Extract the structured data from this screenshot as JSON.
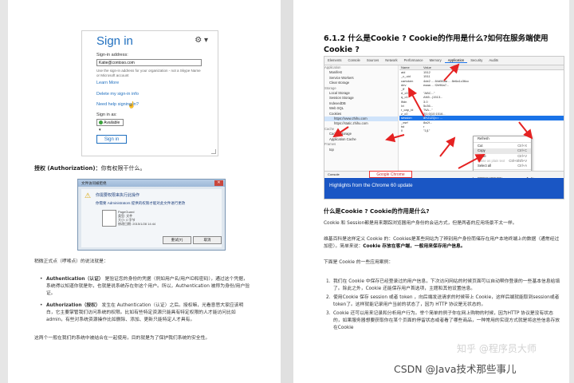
{
  "left": {
    "signin": {
      "title": "Sign in",
      "address_label": "Sign-in address:",
      "address_value": "Katie@contoso.com",
      "hint": "Use the sign-in address for your organization - not a Skype Name or Microsoft account",
      "learn_more": "Learn More",
      "delete_info": "Delete my sign-in info",
      "help": "Need help signing in?",
      "sign_in_as": "Sign in as:",
      "status": "Available",
      "button": "Sign in"
    },
    "auth_label": "授权 (Authorization)：",
    "auth_text": "你有权限干什么。",
    "dialog": {
      "title": "文件访问被拒绝",
      "message_1": "你需要权限来执行此操作",
      "message_2": "你需要 Administrators 提供的权限才能对此文件进行更改",
      "file_info": [
        "PageGuard",
        "类型: 文件",
        "大小: 0 字节",
        "修改日期: 2015/1/28 14:44"
      ],
      "retry": "重试(T)",
      "cancel": "取消"
    },
    "intro": "稍微正式点（啰嗦点）的说法就是：",
    "bullet_1_term": "Authentication（认证）",
    "bullet_1_text": "是验证您的身份的凭据（例如用户名/用户ID和密码），通过这个凭据，系统得以知道你就是你，也就是说系统存在你这个用户。所以，Authentication 被称为身份/用户验证。",
    "bullet_2_term": "Authorization（授权）",
    "bullet_2_text": "发生在 Authentication（认证）之后。授权嘛，光看意思大家应该明白，它主要掌管我们访问系统的权限。比如有些特定资源只能具有特定权限的人才能访问比如admin，有些对系统资源操作比如删除、添加、更新只能特定人才具有。",
    "closing": "这两个一般在我们的系统中被结合在一起使用，目的就是为了保护我们系统的安全性。"
  },
  "right": {
    "heading": "6.1.2 什么是Cookie ? Cookie的作用是什么?如何在服务端使用 Cookie ?",
    "devtools": {
      "tabs": [
        "Elements",
        "Console",
        "Sources",
        "Network",
        "Performance",
        "Memory",
        "Application",
        "Security",
        "Audits"
      ],
      "active_tab": "Application",
      "sidebar": [
        {
          "text": "Application",
          "kind": "grp"
        },
        {
          "text": "Manifest",
          "kind": "ind1"
        },
        {
          "text": "Service Workers",
          "kind": "ind1"
        },
        {
          "text": "Clear storage",
          "kind": "ind1"
        },
        {
          "text": "Storage",
          "kind": "grp"
        },
        {
          "text": "Local Storage",
          "kind": "ind1"
        },
        {
          "text": "Session Storage",
          "kind": "ind1"
        },
        {
          "text": "IndexedDB",
          "kind": "ind1"
        },
        {
          "text": "Web SQL",
          "kind": "ind1"
        },
        {
          "text": "Cookies",
          "kind": "ind1"
        },
        {
          "text": "https://www.zhihu.com",
          "kind": "ind2 sel"
        },
        {
          "text": "https://static.zhihu.com",
          "kind": "ind2"
        },
        {
          "text": "Cache",
          "kind": "grp"
        },
        {
          "text": "Cache Storage",
          "kind": "ind1"
        },
        {
          "text": "Application Cache",
          "kind": "ind1"
        },
        {
          "text": "Frames",
          "kind": "grp"
        },
        {
          "text": "top",
          "kind": "ind1"
        }
      ],
      "table_header": [
        "Name",
        "Value"
      ],
      "rows": [
        {
          "name": "aid",
          "value": "1512"
        },
        {
          "name": "_c_uid",
          "value": "1511"
        },
        {
          "name": "cartoken",
          "value": "4de2  ...  84d56aa  ...  8e6a1c36cc"
        },
        {
          "name": "dev",
          "value": "eaaa    ...    f2e96a7..."
        },
        {
          "name": "_ff",
          "value": ""
        },
        {
          "name": "d_c0",
          "value": "\"ABC...\""
        },
        {
          "name": "q_c1",
          "value": "AN5...|1513..."
        },
        {
          "name": "lfidn",
          "value": "3.0"
        },
        {
          "name": "lvi",
          "value": "5c36..."
        },
        {
          "name": "r_cap_id",
          "value": "\"NA...\""
        },
        {
          "name": "z_c0",
          "value": "2|1:0|10:1516..."
        },
        {
          "name": "session",
          "value": "dHJ1ZQ==  ...",
          "highlight": true
        },
        {
          "name": "_xsrf",
          "value": "8a2f..."
        },
        {
          "name": "tst",
          "value": "r"
        },
        {
          "name": "ll",
          "value": "\"1|1\""
        }
      ],
      "context_menu": [
        {
          "label": "Refresh",
          "shortcut": ""
        },
        {
          "sep": true
        },
        {
          "label": "Cut",
          "shortcut": "Ctrl+X"
        },
        {
          "label": "Copy",
          "shortcut": "Ctrl+C",
          "highlight": true
        },
        {
          "label": "Paste",
          "shortcut": "Ctrl+V"
        },
        {
          "label": "Paste as plain text",
          "shortcut": "Ctrl+Shift+V",
          "disabled": true
        },
        {
          "label": "Select all",
          "shortcut": "Ctrl+A"
        },
        {
          "sep": true
        },
        {
          "label": "Spellcheck",
          "shortcut": "",
          "submenu": true
        },
        {
          "label": "Writing Direction",
          "shortcut": "",
          "submenu": true
        }
      ],
      "console_label": "Console",
      "google_chrome": "Google Chrome",
      "promo": "Highlights from the Chrome 60 update"
    },
    "subheading": "什么是Cookie ? Cookie的作用是什么?",
    "p1": "Cookie 和 Session都是用来跟踪浏览器用户身份的会话方式，但是两者的应用场景不太一样。",
    "p2_a": "维基百科是这样定义 Cookie 的：Cookies是某些网站为了辨别用户身份而储存在用户本地终端上的数据（通常经过加密）。简单来说：",
    "p2_b": "Cookie 存放在客户端，一般用来保存用户信息。",
    "p3": "下面是 Cookie 的一些应用案例：",
    "items": [
      "我们在 Cookie 中保存已经登录过的用户信息，下次访问网站的时候页面可以自动帮你登录的一些基本信息给填了。除此之外，Cookie 还能保存用户首选项，主题和其他设置信息。",
      "使用Cookie 保存 session 或者 token ，向后端发送请求的时候带上 Cookie，这样后端就能取到session或者token了。这样就能记录用户当前的状态了，因为 HTTP 协议是无状态的。",
      "Cookie 还可以用来记录和分析用户行为。举个简单的例子你在网上购物的时候，因为HTTP 协议是没有状态的，如果服务器想要获取你在某个页面的停留状态或者看了哪些商品，一种常用的实现方式就是将这些信息存放在Cookie"
    ]
  },
  "watermarks": {
    "zhihu": "知乎 @程序员大师",
    "csdn": "CSDN @Java技术那些事儿"
  }
}
